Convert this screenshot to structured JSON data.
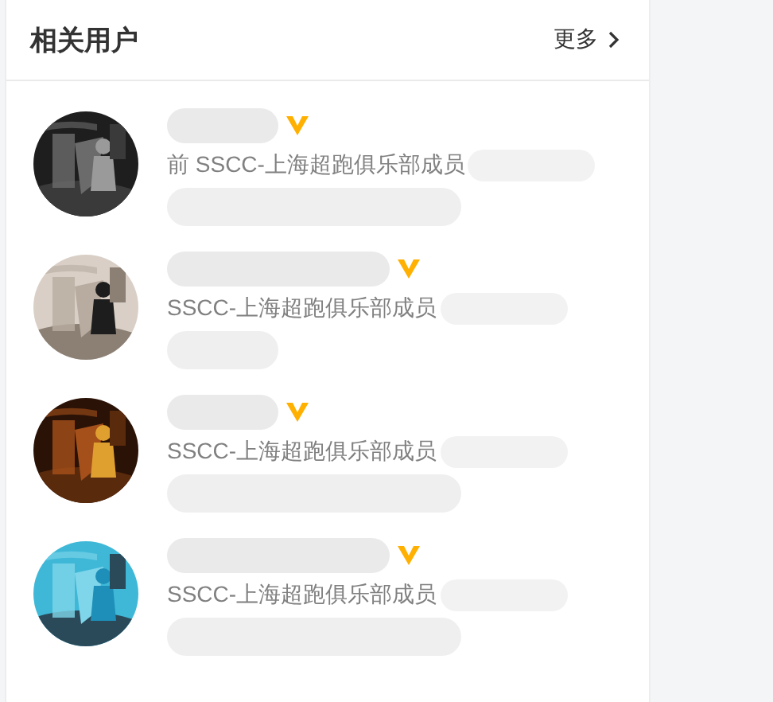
{
  "panel": {
    "title": "相关用户",
    "more_label": "更多"
  },
  "users": [
    {
      "description": "前 SSCC-上海超跑俱乐部成员",
      "verified": true
    },
    {
      "description": "SSCC-上海超跑俱乐部成员",
      "verified": true
    },
    {
      "description": "SSCC-上海超跑俱乐部成员",
      "verified": true
    },
    {
      "description": "SSCC-上海超跑俱乐部成员",
      "verified": true
    }
  ]
}
